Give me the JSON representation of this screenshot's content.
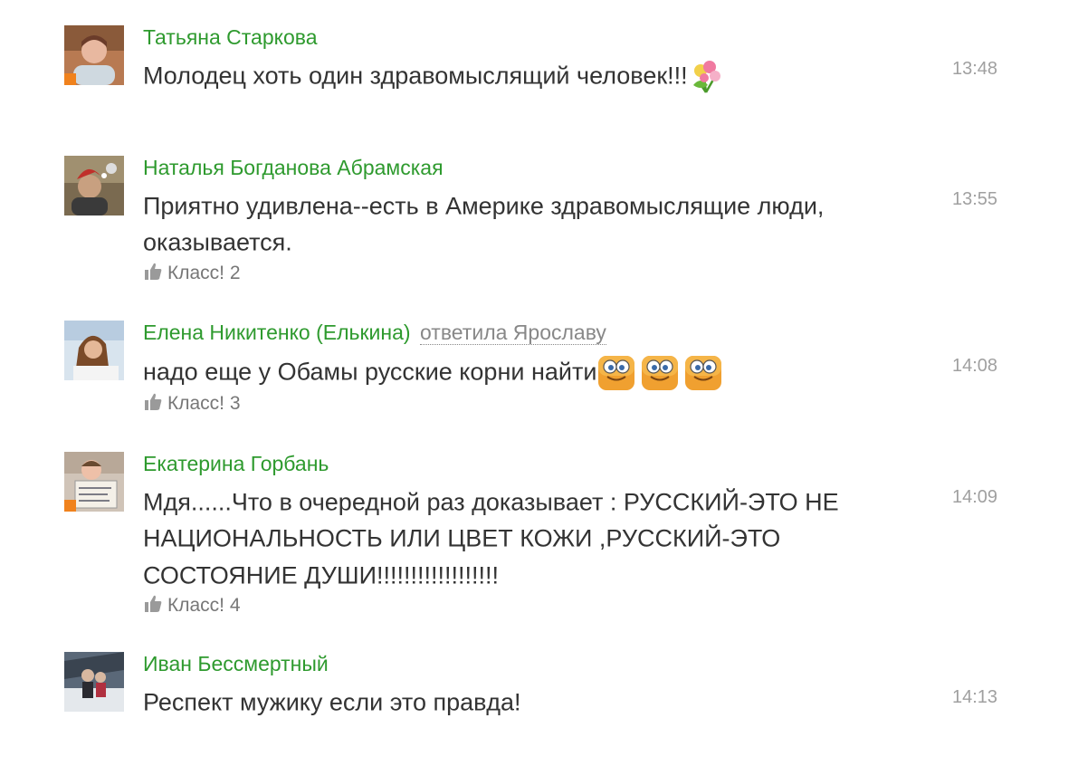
{
  "like_label": "Класс!",
  "comments": [
    {
      "author": "Татьяна Старкова",
      "text": "Молодец хоть один здравомыслящий человек!!!",
      "time": "13:48",
      "online": true,
      "emojis": [
        "flowers-emoji"
      ]
    },
    {
      "author": "Наталья Богданова Абрамская",
      "text": "Приятно удивлена--есть в Америке здравомыслящие люди, оказывается.",
      "time": "13:55",
      "online": false,
      "likes": "2"
    },
    {
      "author": "Елена Никитенко (Елькина)",
      "reply": "ответила Ярославу",
      "text": "надо еще у Обамы русские корни найти",
      "time": "14:08",
      "online": false,
      "likes": "3",
      "emojis": [
        "smiley-emoji",
        "smiley-emoji",
        "smiley-emoji"
      ]
    },
    {
      "author": "Екатерина Горбань",
      "text": "Мдя......Что в очередной раз доказывает : РУССКИЙ-ЭТО НЕ НАЦИОНАЛЬНОСТЬ ИЛИ ЦВЕТ КОЖИ ,РУССКИЙ-ЭТО СОСТОЯНИЕ ДУШИ!!!!!!!!!!!!!!!!!!",
      "time": "14:09",
      "online": true,
      "likes": "4"
    },
    {
      "author": "Иван Бессмертный",
      "text": "Респект мужику если это правда!",
      "time": "14:13",
      "online": false
    }
  ]
}
